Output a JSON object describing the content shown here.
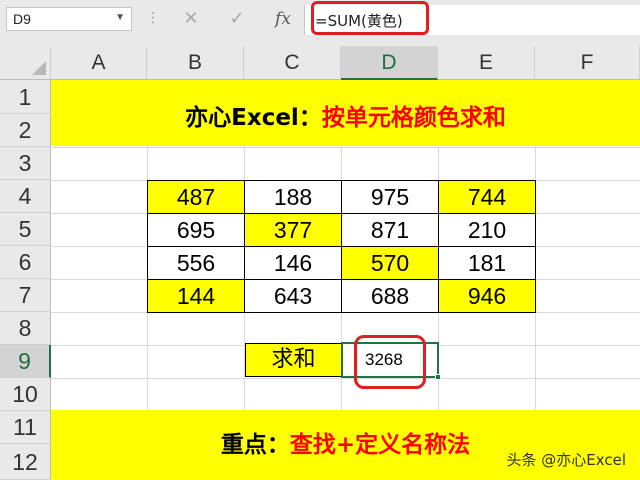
{
  "formula_bar": {
    "name_box": "D9",
    "cancel_icon": "✕",
    "enter_icon": "✓",
    "fx_label": "fx",
    "formula": "=SUM(黄色)"
  },
  "columns": [
    "A",
    "B",
    "C",
    "D",
    "E",
    "F"
  ],
  "active_column": "D",
  "rows": [
    "1",
    "2",
    "3",
    "4",
    "5",
    "6",
    "7",
    "8",
    "9",
    "10",
    "11",
    "12"
  ],
  "active_row": "9",
  "title": {
    "black_part": "亦心Excel：",
    "red_part": "按单元格颜色求和"
  },
  "table": [
    [
      {
        "v": "487",
        "yellow": true
      },
      {
        "v": "188",
        "yellow": false
      },
      {
        "v": "975",
        "yellow": false
      },
      {
        "v": "744",
        "yellow": true
      }
    ],
    [
      {
        "v": "695",
        "yellow": false
      },
      {
        "v": "377",
        "yellow": true
      },
      {
        "v": "871",
        "yellow": false
      },
      {
        "v": "210",
        "yellow": false
      }
    ],
    [
      {
        "v": "556",
        "yellow": false
      },
      {
        "v": "146",
        "yellow": false
      },
      {
        "v": "570",
        "yellow": true
      },
      {
        "v": "181",
        "yellow": false
      }
    ],
    [
      {
        "v": "144",
        "yellow": true
      },
      {
        "v": "643",
        "yellow": false
      },
      {
        "v": "688",
        "yellow": false
      },
      {
        "v": "946",
        "yellow": true
      }
    ]
  ],
  "sum": {
    "label": "求和",
    "value": "3268"
  },
  "footer": {
    "black_part": "重点：",
    "red_part": "查找+定义名称法"
  },
  "watermark": "头条 @亦心Excel",
  "colors": {
    "highlight": "#ffff00",
    "emphasis_red": "#ff0000",
    "excel_green": "#217346",
    "callout_red": "#e02020"
  }
}
